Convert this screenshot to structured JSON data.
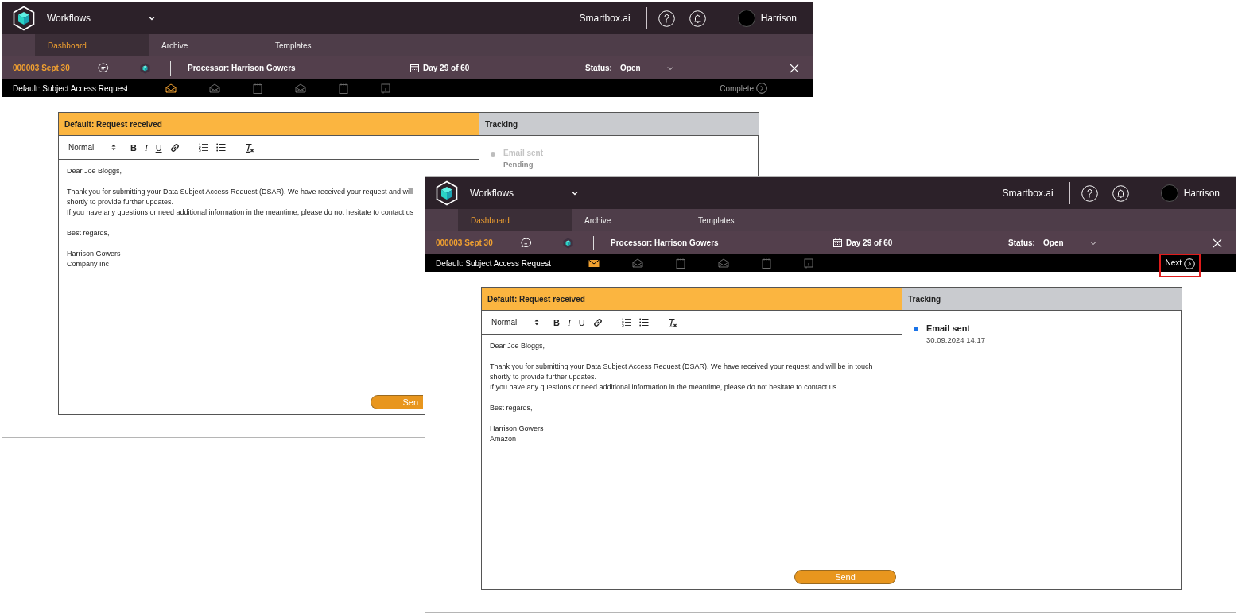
{
  "windows": [
    {
      "app_title": "Workflows",
      "brand": "Smartbox.ai",
      "user": "Harrison",
      "tabs": [
        {
          "label": "Dashboard",
          "selected": true
        },
        {
          "label": "Archive",
          "selected": false
        },
        {
          "label": "Templates",
          "selected": false
        }
      ],
      "case": {
        "id": "000003 Sept 30",
        "processor": "Processor: Harrison Gowers",
        "day": "Day 29 of 60",
        "status_label": "Status:",
        "status": "Open"
      },
      "workflow": "Default: Subject Access Request",
      "steps": [
        {
          "kind": "mail-open",
          "active": true
        },
        {
          "kind": "mail-open",
          "active": false
        },
        {
          "kind": "notepad",
          "active": false
        },
        {
          "kind": "mail-open",
          "active": false
        },
        {
          "kind": "notepad",
          "active": false
        },
        {
          "kind": "info",
          "active": false
        }
      ],
      "step_action": {
        "label": "Complete",
        "disabled": true,
        "highlighted": false
      },
      "editor": {
        "title": "Default: Request received",
        "format": "Normal",
        "tools": [
          {
            "kind": "bold",
            "label": "B"
          },
          {
            "kind": "italic",
            "label": "I"
          },
          {
            "kind": "underline",
            "label": "U"
          },
          {
            "kind": "link"
          },
          {
            "kind": "ordered-list"
          },
          {
            "kind": "bullet-list"
          },
          {
            "kind": "clear-format"
          }
        ],
        "paragraphs": [
          [
            "Dear Joe Bloggs,"
          ],
          [
            "Thank you for submitting your Data Subject Access Request (DSAR). We have received your request and will",
            "shortly to provide further updates.",
            "If you have any questions or need additional information in the meantime, please do not hesitate to contact us"
          ],
          [
            "Best regards,"
          ],
          [
            "Harrison Gowers",
            "Company Inc"
          ]
        ],
        "send": "Sen"
      },
      "tracking": {
        "title": "Tracking",
        "events": [
          {
            "title": "Email sent",
            "detail": "Pending",
            "done": false
          }
        ]
      }
    },
    {
      "app_title": "Workflows",
      "brand": "Smartbox.ai",
      "user": "Harrison",
      "tabs": [
        {
          "label": "Dashboard",
          "selected": true
        },
        {
          "label": "Archive",
          "selected": false
        },
        {
          "label": "Templates",
          "selected": false
        }
      ],
      "case": {
        "id": "000003 Sept 30",
        "processor": "Processor: Harrison Gowers",
        "day": "Day 29 of 60",
        "status_label": "Status:",
        "status": "Open"
      },
      "workflow": "Default: Subject Access Request",
      "steps": [
        {
          "kind": "mail",
          "active": true
        },
        {
          "kind": "mail-open",
          "active": false
        },
        {
          "kind": "notepad",
          "active": false
        },
        {
          "kind": "mail-open",
          "active": false
        },
        {
          "kind": "notepad",
          "active": false
        },
        {
          "kind": "info",
          "active": false
        }
      ],
      "step_action": {
        "label": "Next",
        "disabled": false,
        "highlighted": true
      },
      "editor": {
        "title": "Default: Request received",
        "format": "Normal",
        "tools": [
          {
            "kind": "bold",
            "label": "B"
          },
          {
            "kind": "italic",
            "label": "I"
          },
          {
            "kind": "underline",
            "label": "U"
          },
          {
            "kind": "link"
          },
          {
            "kind": "ordered-list"
          },
          {
            "kind": "bullet-list"
          },
          {
            "kind": "clear-format"
          }
        ],
        "paragraphs": [
          [
            "Dear Joe Bloggs,"
          ],
          [
            "Thank you for submitting your Data Subject Access Request (DSAR). We have received your request and will be in touch",
            "shortly to provide further updates.",
            "If you have any questions or need additional information in the meantime, please do not hesitate to contact us."
          ],
          [
            "Best regards,"
          ],
          [
            "Harrison Gowers",
            "Amazon"
          ]
        ],
        "send": "Send"
      },
      "tracking": {
        "title": "Tracking",
        "events": [
          {
            "title": "Email sent",
            "detail": "30.09.2024 14:17",
            "done": true
          }
        ]
      }
    }
  ]
}
